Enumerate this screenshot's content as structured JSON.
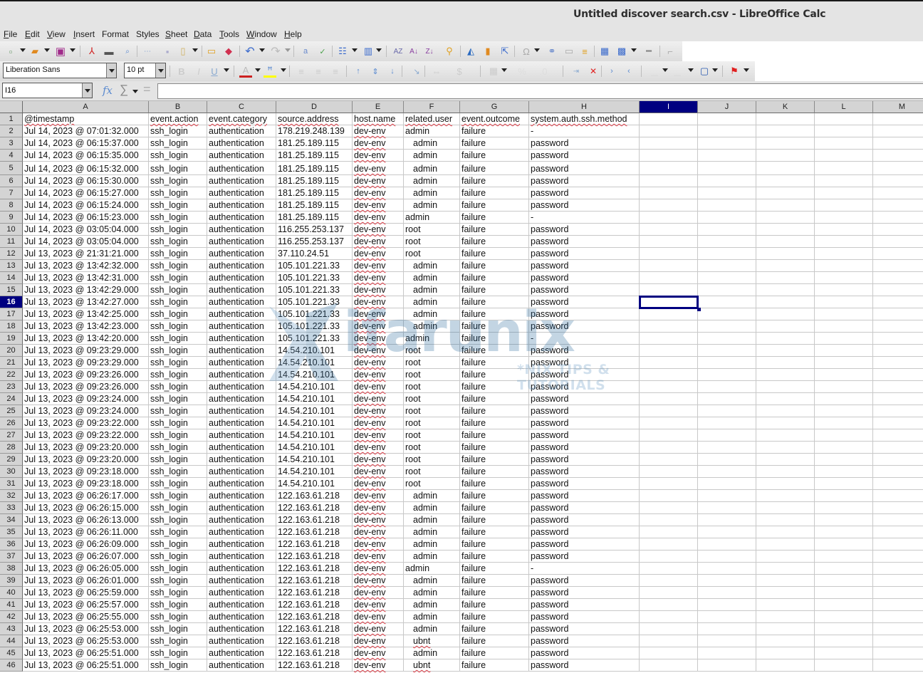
{
  "window": {
    "title": "Untitled discover search.csv - LibreOffice Calc"
  },
  "menu": [
    {
      "label": "File",
      "accel": "F",
      "rest": "ile"
    },
    {
      "label": "Edit",
      "accel": "E",
      "rest": "dit"
    },
    {
      "label": "View",
      "accel": "V",
      "rest": "iew"
    },
    {
      "label": "Insert",
      "accel": "I",
      "rest": "nsert"
    },
    {
      "label": "Format",
      "accel": "",
      "rest": "Format"
    },
    {
      "label": "Styles",
      "accel": "",
      "rest": "Styles"
    },
    {
      "label": "Sheet",
      "accel": "S",
      "rest": "heet"
    },
    {
      "label": "Data",
      "accel": "D",
      "rest": "ata"
    },
    {
      "label": "Tools",
      "accel": "T",
      "rest": "ools"
    },
    {
      "label": "Window",
      "accel": "W",
      "rest": "indow"
    },
    {
      "label": "Help",
      "accel": "H",
      "rest": "elp"
    }
  ],
  "formatting": {
    "font_name": "Liberation Sans",
    "font_size": "10 pt"
  },
  "formula_bar": {
    "name_box": "I16",
    "formula": "",
    "fx_symbol": "𝑓x",
    "sum_symbol": "∑",
    "equals_symbol": "="
  },
  "colors": {
    "selection": "#000080",
    "spell_underline": "#e0404a",
    "header_bg": "#d4d4d4",
    "font_color_bar": "#cc2020",
    "highlight_bar": "#ffff00"
  },
  "watermark": {
    "brand": "ifarunix",
    "tagline": "*NIX TIPS & TUTORIALS"
  },
  "sheet": {
    "active_cell": "I16",
    "columns": [
      "A",
      "B",
      "C",
      "D",
      "E",
      "F",
      "G",
      "H",
      "I",
      "J",
      "K",
      "L",
      "M"
    ],
    "selected_column": "I",
    "selected_row": 16,
    "header_row": [
      "@timestamp",
      "event.action",
      "event.category",
      "source.address",
      "host.name",
      "related.user",
      "event.outcome",
      "system.auth.ssh.method"
    ],
    "rows": [
      [
        "Jul 14, 2023 @ 07:01:32.000",
        "ssh_login",
        "authentication",
        "178.219.248.139",
        "dev-env",
        "admin",
        "failure",
        "-"
      ],
      [
        "Jul 14, 2023 @ 06:15:37.000",
        "ssh_login",
        "authentication",
        "181.25.189.115",
        "dev-env",
        " admin",
        "failure",
        "password"
      ],
      [
        "Jul 14, 2023 @ 06:15:35.000",
        "ssh_login",
        "authentication",
        "181.25.189.115",
        "dev-env",
        " admin",
        "failure",
        "password"
      ],
      [
        "Jul 14, 2023 @ 06:15:32.000",
        "ssh_login",
        "authentication",
        "181.25.189.115",
        "dev-env",
        " admin",
        "failure",
        "password"
      ],
      [
        "Jul 14, 2023 @ 06:15:30.000",
        "ssh_login",
        "authentication",
        "181.25.189.115",
        "dev-env",
        " admin",
        "failure",
        "password"
      ],
      [
        "Jul 14, 2023 @ 06:15:27.000",
        "ssh_login",
        "authentication",
        "181.25.189.115",
        "dev-env",
        " admin",
        "failure",
        "password"
      ],
      [
        "Jul 14, 2023 @ 06:15:24.000",
        "ssh_login",
        "authentication",
        "181.25.189.115",
        "dev-env",
        " admin",
        "failure",
        "password"
      ],
      [
        "Jul 14, 2023 @ 06:15:23.000",
        "ssh_login",
        "authentication",
        "181.25.189.115",
        "dev-env",
        "admin",
        "failure",
        "-"
      ],
      [
        "Jul 14, 2023 @ 03:05:04.000",
        "ssh_login",
        "authentication",
        "116.255.253.137",
        "dev-env",
        "root",
        "failure",
        "password"
      ],
      [
        "Jul 14, 2023 @ 03:05:04.000",
        "ssh_login",
        "authentication",
        "116.255.253.137",
        "dev-env",
        "root",
        "failure",
        "password"
      ],
      [
        "Jul 13, 2023 @ 21:31:21.000",
        "ssh_login",
        "authentication",
        "37.110.24.51",
        "dev-env",
        "root",
        "failure",
        "password"
      ],
      [
        "Jul 13, 2023 @ 13:42:32.000",
        "ssh_login",
        "authentication",
        "105.101.221.33",
        "dev-env",
        " admin",
        "failure",
        "password"
      ],
      [
        "Jul 13, 2023 @ 13:42:31.000",
        "ssh_login",
        "authentication",
        "105.101.221.33",
        "dev-env",
        " admin",
        "failure",
        "password"
      ],
      [
        "Jul 13, 2023 @ 13:42:29.000",
        "ssh_login",
        "authentication",
        "105.101.221.33",
        "dev-env",
        " admin",
        "failure",
        "password"
      ],
      [
        "Jul 13, 2023 @ 13:42:27.000",
        "ssh_login",
        "authentication",
        "105.101.221.33",
        "dev-env",
        " admin",
        "failure",
        "password"
      ],
      [
        "Jul 13, 2023 @ 13:42:25.000",
        "ssh_login",
        "authentication",
        "105.101.221.33",
        "dev-env",
        " admin",
        "failure",
        "password"
      ],
      [
        "Jul 13, 2023 @ 13:42:23.000",
        "ssh_login",
        "authentication",
        "105.101.221.33",
        "dev-env",
        " admin",
        "failure",
        "password"
      ],
      [
        "Jul 13, 2023 @ 13:42:20.000",
        "ssh_login",
        "authentication",
        "105.101.221.33",
        "dev-env",
        "admin",
        "failure",
        "-"
      ],
      [
        "Jul 13, 2023 @ 09:23:29.000",
        "ssh_login",
        "authentication",
        "14.54.210.101",
        "dev-env",
        "root",
        "failure",
        "password"
      ],
      [
        "Jul 13, 2023 @ 09:23:29.000",
        "ssh_login",
        "authentication",
        "14.54.210.101",
        "dev-env",
        "root",
        "failure",
        "password"
      ],
      [
        "Jul 13, 2023 @ 09:23:26.000",
        "ssh_login",
        "authentication",
        "14.54.210.101",
        "dev-env",
        "root",
        "failure",
        "password"
      ],
      [
        "Jul 13, 2023 @ 09:23:26.000",
        "ssh_login",
        "authentication",
        "14.54.210.101",
        "dev-env",
        "root",
        "failure",
        "password"
      ],
      [
        "Jul 13, 2023 @ 09:23:24.000",
        "ssh_login",
        "authentication",
        "14.54.210.101",
        "dev-env",
        "root",
        "failure",
        "password"
      ],
      [
        "Jul 13, 2023 @ 09:23:24.000",
        "ssh_login",
        "authentication",
        "14.54.210.101",
        "dev-env",
        "root",
        "failure",
        "password"
      ],
      [
        "Jul 13, 2023 @ 09:23:22.000",
        "ssh_login",
        "authentication",
        "14.54.210.101",
        "dev-env",
        "root",
        "failure",
        "password"
      ],
      [
        "Jul 13, 2023 @ 09:23:22.000",
        "ssh_login",
        "authentication",
        "14.54.210.101",
        "dev-env",
        "root",
        "failure",
        "password"
      ],
      [
        "Jul 13, 2023 @ 09:23:20.000",
        "ssh_login",
        "authentication",
        "14.54.210.101",
        "dev-env",
        "root",
        "failure",
        "password"
      ],
      [
        "Jul 13, 2023 @ 09:23:20.000",
        "ssh_login",
        "authentication",
        "14.54.210.101",
        "dev-env",
        "root",
        "failure",
        "password"
      ],
      [
        "Jul 13, 2023 @ 09:23:18.000",
        "ssh_login",
        "authentication",
        "14.54.210.101",
        "dev-env",
        "root",
        "failure",
        "password"
      ],
      [
        "Jul 13, 2023 @ 09:23:18.000",
        "ssh_login",
        "authentication",
        "14.54.210.101",
        "dev-env",
        "root",
        "failure",
        "password"
      ],
      [
        "Jul 13, 2023 @ 06:26:17.000",
        "ssh_login",
        "authentication",
        "122.163.61.218",
        "dev-env",
        " admin",
        "failure",
        "password"
      ],
      [
        "Jul 13, 2023 @ 06:26:15.000",
        "ssh_login",
        "authentication",
        "122.163.61.218",
        "dev-env",
        " admin",
        "failure",
        "password"
      ],
      [
        "Jul 13, 2023 @ 06:26:13.000",
        "ssh_login",
        "authentication",
        "122.163.61.218",
        "dev-env",
        " admin",
        "failure",
        "password"
      ],
      [
        "Jul 13, 2023 @ 06:26:11.000",
        "ssh_login",
        "authentication",
        "122.163.61.218",
        "dev-env",
        " admin",
        "failure",
        "password"
      ],
      [
        "Jul 13, 2023 @ 06:26:09.000",
        "ssh_login",
        "authentication",
        "122.163.61.218",
        "dev-env",
        " admin",
        "failure",
        "password"
      ],
      [
        "Jul 13, 2023 @ 06:26:07.000",
        "ssh_login",
        "authentication",
        "122.163.61.218",
        "dev-env",
        " admin",
        "failure",
        "password"
      ],
      [
        "Jul 13, 2023 @ 06:26:05.000",
        "ssh_login",
        "authentication",
        "122.163.61.218",
        "dev-env",
        "admin",
        "failure",
        "-"
      ],
      [
        "Jul 13, 2023 @ 06:26:01.000",
        "ssh_login",
        "authentication",
        "122.163.61.218",
        "dev-env",
        " admin",
        "failure",
        "password"
      ],
      [
        "Jul 13, 2023 @ 06:25:59.000",
        "ssh_login",
        "authentication",
        "122.163.61.218",
        "dev-env",
        " admin",
        "failure",
        "password"
      ],
      [
        "Jul 13, 2023 @ 06:25:57.000",
        "ssh_login",
        "authentication",
        "122.163.61.218",
        "dev-env",
        " admin",
        "failure",
        "password"
      ],
      [
        "Jul 13, 2023 @ 06:25:55.000",
        "ssh_login",
        "authentication",
        "122.163.61.218",
        "dev-env",
        " admin",
        "failure",
        "password"
      ],
      [
        "Jul 13, 2023 @ 06:25:53.000",
        "ssh_login",
        "authentication",
        "122.163.61.218",
        "dev-env",
        " admin",
        "failure",
        "password"
      ],
      [
        "Jul 13, 2023 @ 06:25:53.000",
        "ssh_login",
        "authentication",
        "122.163.61.218",
        "dev-env",
        " ubnt",
        "failure",
        "password"
      ],
      [
        "Jul 13, 2023 @ 06:25:51.000",
        "ssh_login",
        "authentication",
        "122.163.61.218",
        "dev-env",
        " admin",
        "failure",
        "password"
      ],
      [
        "Jul 13, 2023 @ 06:25:51.000",
        "ssh_login",
        "authentication",
        "122.163.61.218",
        "dev-env",
        " ubnt",
        "failure",
        "password"
      ]
    ]
  }
}
